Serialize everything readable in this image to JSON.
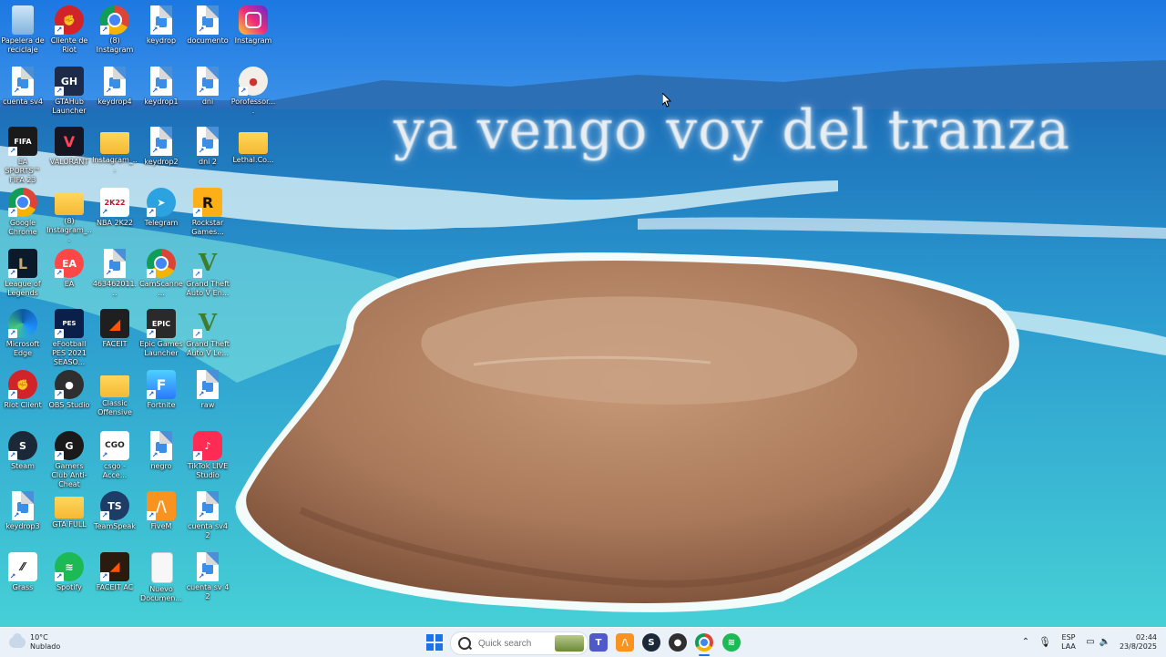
{
  "wallpaper": {
    "overlay_text": "ya vengo voy del tranza"
  },
  "desktop": {
    "icons": [
      {
        "label": "Papelera de reciclaje",
        "icon": "recycle-bin-icon"
      },
      {
        "label": "Cliente de Riot",
        "icon": "riot-client-icon"
      },
      {
        "label": "(8) Instagram",
        "icon": "chrome-icon"
      },
      {
        "label": "keydrop",
        "icon": "shortcut-file-icon"
      },
      {
        "label": "documento",
        "icon": "shortcut-file-icon"
      },
      {
        "label": "Instagram",
        "icon": "instagram-icon"
      },
      {
        "label": "cuenta sv4",
        "icon": "shortcut-file-icon"
      },
      {
        "label": "GTAHub Launcher",
        "icon": "gtahub-icon"
      },
      {
        "label": "keydrop4",
        "icon": "shortcut-file-icon"
      },
      {
        "label": "keydrop1",
        "icon": "shortcut-file-icon"
      },
      {
        "label": "dni",
        "icon": "shortcut-file-icon"
      },
      {
        "label": "Porofessor....",
        "icon": "porofessor-icon"
      },
      {
        "label": "EA SPORTS™ FIFA 23",
        "icon": "fifa-icon"
      },
      {
        "label": "VALORANT",
        "icon": "valorant-icon"
      },
      {
        "label": "Instagram_...",
        "icon": "folder-icon"
      },
      {
        "label": "keydrop2",
        "icon": "shortcut-file-icon"
      },
      {
        "label": "dni 2",
        "icon": "shortcut-file-icon"
      },
      {
        "label": "Lethal.Co...",
        "icon": "folder-icon"
      },
      {
        "label": "Google Chrome",
        "icon": "chrome-icon"
      },
      {
        "label": "(8) Instagram_...",
        "icon": "folder-icon"
      },
      {
        "label": "NBA 2K22",
        "icon": "nba-icon"
      },
      {
        "label": "Telegram",
        "icon": "telegram-icon"
      },
      {
        "label": "Rockstar Games...",
        "icon": "rockstar-icon"
      },
      {
        "label": "League of Legends",
        "icon": "league-icon"
      },
      {
        "label": "EA",
        "icon": "ea-icon"
      },
      {
        "label": "463462011...",
        "icon": "shortcut-file-icon"
      },
      {
        "label": "CamScanne...",
        "icon": "chrome-icon"
      },
      {
        "label": "Grand Theft Auto V En...",
        "icon": "gtav-icon"
      },
      {
        "label": "Microsoft Edge",
        "icon": "edge-icon"
      },
      {
        "label": "eFootball PES 2021 SEASO...",
        "icon": "pes-icon"
      },
      {
        "label": "FACEIT",
        "icon": "faceit-icon"
      },
      {
        "label": "Epic Games Launcher",
        "icon": "epic-icon"
      },
      {
        "label": "Grand Theft Auto V Le...",
        "icon": "gtav-icon"
      },
      {
        "label": "Riot Client",
        "icon": "riot-client-icon"
      },
      {
        "label": "OBS Studio",
        "icon": "obs-icon"
      },
      {
        "label": "Classic Offensive",
        "icon": "folder-icon"
      },
      {
        "label": "Fortnite",
        "icon": "fortnite-icon"
      },
      {
        "label": "raw",
        "icon": "shortcut-file-icon"
      },
      {
        "label": "Steam",
        "icon": "steam-icon"
      },
      {
        "label": "Gamers Club Anti-Cheat",
        "icon": "gamersclub-icon"
      },
      {
        "label": "csgo - Acce...",
        "icon": "csgo-icon"
      },
      {
        "label": "negro",
        "icon": "shortcut-file-icon"
      },
      {
        "label": "TikTok LIVE Studio",
        "icon": "tiktok-icon"
      },
      {
        "label": "keydrop3",
        "icon": "shortcut-file-icon"
      },
      {
        "label": "GTA FULL",
        "icon": "folder-icon"
      },
      {
        "label": "TeamSpeak",
        "icon": "teamspeak-icon"
      },
      {
        "label": "FiveM",
        "icon": "fivem-icon"
      },
      {
        "label": "cuenta sv4 2",
        "icon": "shortcut-file-icon"
      },
      {
        "label": "Grass",
        "icon": "grass-icon"
      },
      {
        "label": "Spotify",
        "icon": "spotify-icon"
      },
      {
        "label": "FACEIT AC",
        "icon": "faceit-ac-icon"
      },
      {
        "label": "Nuevo Documen...",
        "icon": "text-document-icon"
      },
      {
        "label": "cuenta sv 4 2",
        "icon": "shortcut-file-icon"
      }
    ]
  },
  "taskbar": {
    "weather": {
      "temp": "10°C",
      "condition": "Nublado"
    },
    "search": {
      "placeholder": "Quick search"
    },
    "apps": [
      {
        "name": "teams-icon"
      },
      {
        "name": "fivem-icon"
      },
      {
        "name": "steam-icon"
      },
      {
        "name": "obs-icon"
      },
      {
        "name": "chrome-icon"
      },
      {
        "name": "spotify-icon"
      }
    ],
    "tray": {
      "language_line1": "ESP",
      "language_line2": "LAA",
      "time": "02:44",
      "date": "23/8/2025"
    }
  }
}
